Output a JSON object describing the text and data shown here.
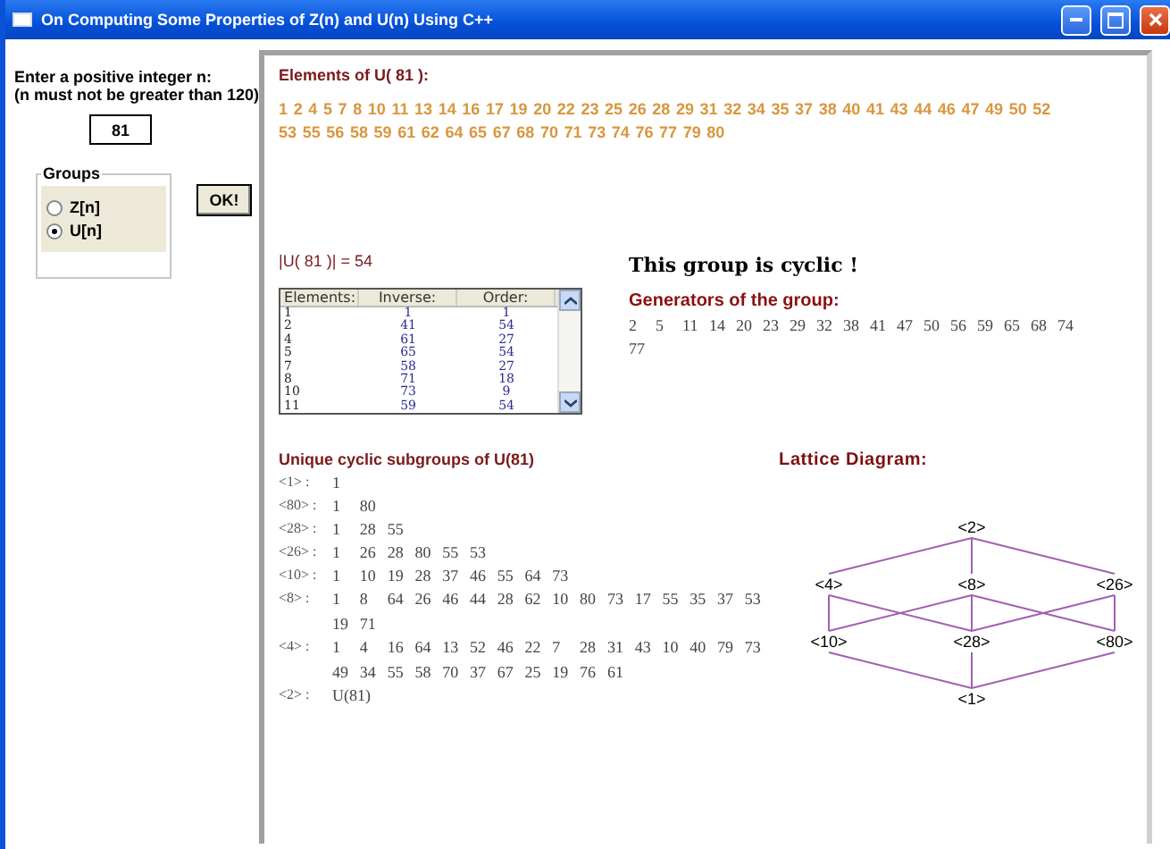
{
  "window": {
    "title": "On Computing Some Properties of Z(n) and U(n) Using C++"
  },
  "input_panel": {
    "prompt": "Enter a positive integer n:",
    "note": "(n must not be greater than 120)",
    "value": "81"
  },
  "groups": {
    "legend": "Groups",
    "options": [
      {
        "label": "Z[n]",
        "selected": false
      },
      {
        "label": "U[n]",
        "selected": true
      }
    ]
  },
  "ok_button": "OK!",
  "elements": {
    "title": "Elements of U( 81 ):",
    "values": [
      "1",
      "2",
      "4",
      "5",
      "7",
      "8",
      "10",
      "11",
      "13",
      "14",
      "16",
      "17",
      "19",
      "20",
      "22",
      "23",
      "25",
      "26",
      "28",
      "29",
      "31",
      "32",
      "34",
      "35",
      "37",
      "38",
      "40",
      "41",
      "43",
      "44",
      "46",
      "47",
      "49",
      "50",
      "52",
      "53",
      "55",
      "56",
      "58",
      "59",
      "61",
      "62",
      "64",
      "65",
      "67",
      "68",
      "70",
      "71",
      "73",
      "74",
      "76",
      "77",
      "79",
      "80"
    ]
  },
  "order_text": "|U( 81 )| =  54",
  "table": {
    "columns": [
      "Elements:",
      "Inverse:",
      "Order:"
    ],
    "rows": [
      [
        "1",
        "1",
        "1"
      ],
      [
        "2",
        "41",
        "54"
      ],
      [
        "4",
        "61",
        "27"
      ],
      [
        "5",
        "65",
        "54"
      ],
      [
        "7",
        "58",
        "27"
      ],
      [
        "8",
        "71",
        "18"
      ],
      [
        "10",
        "73",
        "9"
      ],
      [
        "11",
        "59",
        "54"
      ]
    ]
  },
  "cyclic_message": "This group is cyclic !",
  "generators": {
    "title": "Generators of the group:",
    "values": [
      "2",
      "5",
      "11",
      "14",
      "20",
      "23",
      "29",
      "32",
      "38",
      "41",
      "47",
      "50",
      "56",
      "59",
      "65",
      "68",
      "74",
      "77"
    ]
  },
  "subgroups": {
    "title": "Unique cyclic subgroups of U(81)",
    "rows": [
      {
        "label": "<1> :",
        "values": [
          "1"
        ]
      },
      {
        "label": "<80> :",
        "values": [
          "1",
          "80"
        ]
      },
      {
        "label": "<28> :",
        "values": [
          "1",
          "28",
          "55"
        ]
      },
      {
        "label": "<26> :",
        "values": [
          "1",
          "26",
          "28",
          "80",
          "55",
          "53"
        ]
      },
      {
        "label": "<10> :",
        "values": [
          "1",
          "10",
          "19",
          "28",
          "37",
          "46",
          "55",
          "64",
          "73"
        ]
      },
      {
        "label": "<8> :",
        "values": [
          "1",
          "8",
          "64",
          "26",
          "46",
          "44",
          "28",
          "62",
          "10",
          "80",
          "73",
          "17",
          "55",
          "35",
          "37",
          "53",
          "19",
          "71"
        ]
      },
      {
        "label": "<4> :",
        "values": [
          "1",
          "4",
          "16",
          "64",
          "13",
          "52",
          "46",
          "22",
          "7",
          "28",
          "31",
          "43",
          "10",
          "40",
          "79",
          "73",
          "49",
          "34",
          "55",
          "58",
          "70",
          "37",
          "67",
          "25",
          "19",
          "76",
          "61"
        ]
      },
      {
        "label": "<2> :",
        "values": [
          "U(81)"
        ]
      }
    ]
  },
  "lattice": {
    "title": "Lattice Diagram:",
    "levels": [
      [
        "<2>"
      ],
      [
        "<4>",
        "<8>",
        "<26>"
      ],
      [
        "<10>",
        "<28>",
        "<80>"
      ],
      [
        "<1>"
      ]
    ]
  }
}
